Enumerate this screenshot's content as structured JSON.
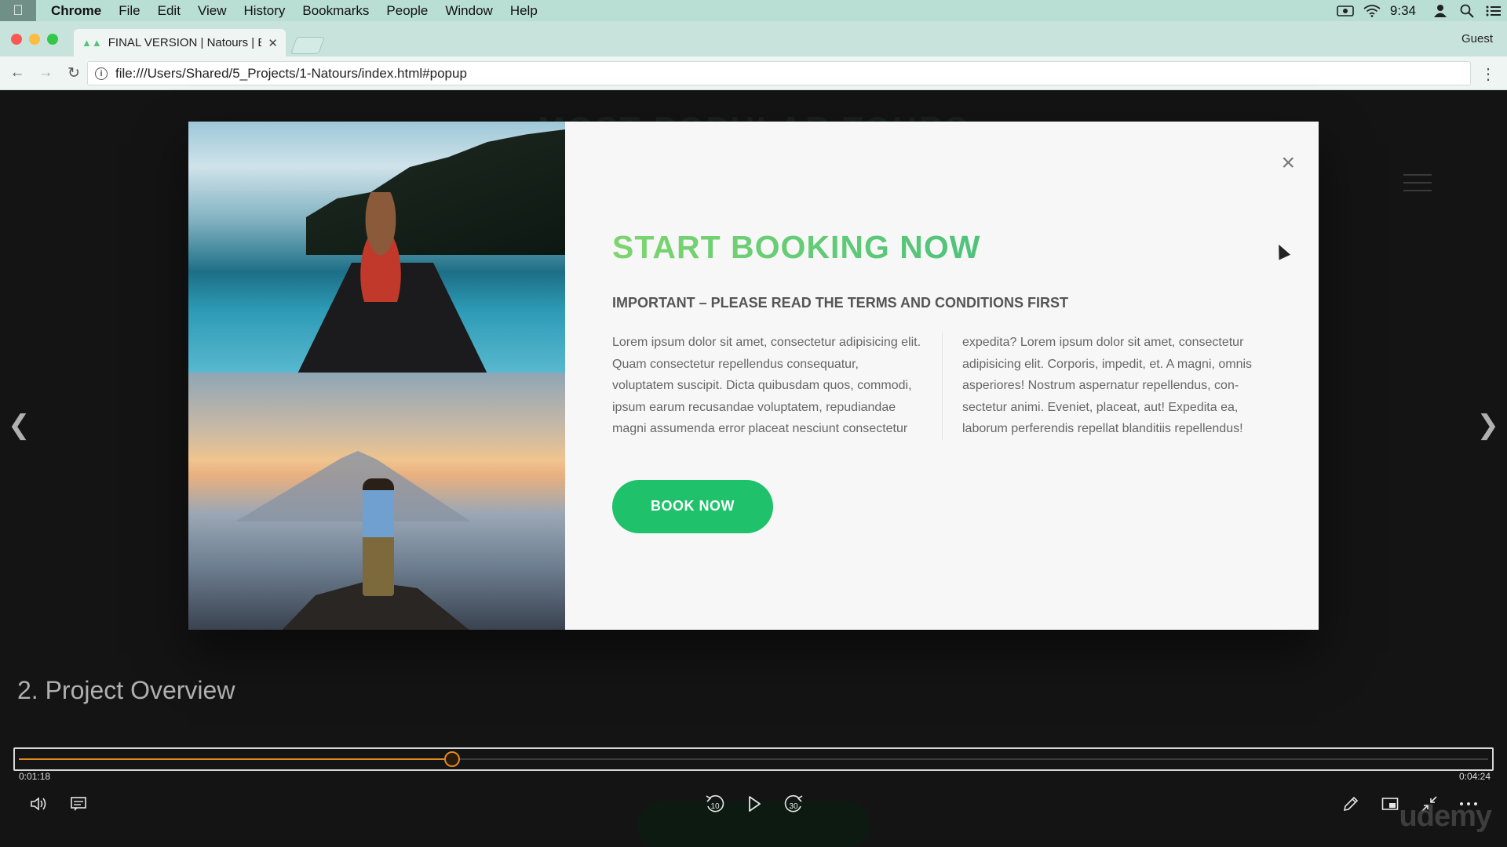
{
  "menubar": {
    "app": "Chrome",
    "items": [
      "File",
      "Edit",
      "View",
      "History",
      "Bookmarks",
      "People",
      "Window",
      "Help"
    ],
    "clock": "9:34"
  },
  "browser": {
    "tab_title": "FINAL VERSION | Natours | Exc",
    "profile": "Guest",
    "url": "file:///Users/Shared/5_Projects/1-Natours/index.html#popup"
  },
  "page": {
    "section_heading": "MOST POPULAR TOURS"
  },
  "popup": {
    "heading": "START BOOKING NOW",
    "subheading": "IMPORTANT – PLEASE READ THE TERMS AND CONDITIONS FIRST",
    "body": "Lorem ipsum dolor sit amet, consectetur adipisicing elit. Quam consectetur repellendus consequatur, voluptatem suscipit. Dicta quibusdam quos, commodi, ipsum earum recusandae voluptatem, repudiandae magni assumenda error placeat nesciunt consectetur expedita? Lorem ipsum dolor sit amet, consectetur adipisicing elit. Corporis, impedit, et. A magni, omnis asperiores! Nostrum aspernatur repellendus, con- sectetur animi. Eveniet, placeat, aut! Expedita ea, laborum perferendis repellat blanditiis repellendus!",
    "button": "BOOK NOW",
    "close_icon": "×"
  },
  "player": {
    "lecture_title": "2. Project Overview",
    "current_time": "0:01:18",
    "total_time": "0:04:24",
    "progress_fraction": 0.295,
    "rewind_label": "10",
    "forward_label": "30",
    "watermark": "udemy",
    "accent_color": "#e1891e"
  }
}
